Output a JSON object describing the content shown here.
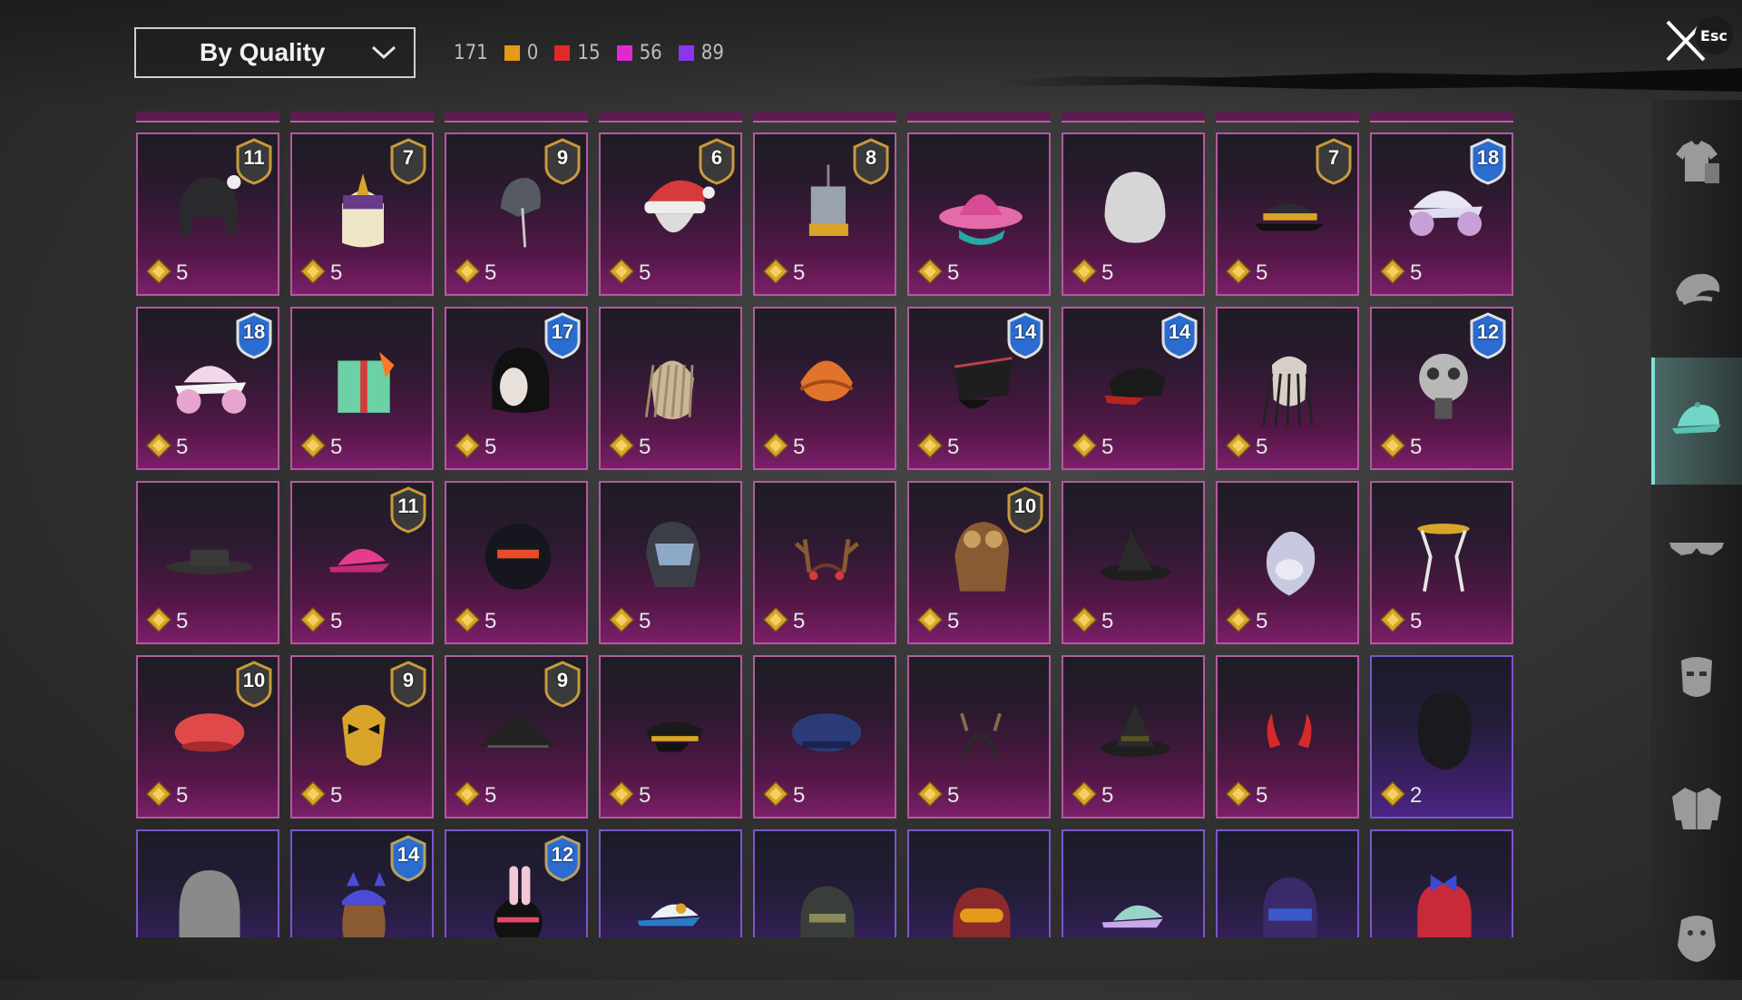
{
  "sort": {
    "label": "By Quality"
  },
  "counts": {
    "total": "171",
    "qualities": [
      {
        "value": "0",
        "color": "#e69a1a"
      },
      {
        "value": "15",
        "color": "#e02a2a"
      },
      {
        "value": "56",
        "color": "#e02ad0"
      },
      {
        "value": "89",
        "color": "#8a36f0"
      }
    ]
  },
  "close": {
    "key_hint": "Esc"
  },
  "sidebar": [
    {
      "icon": "clothing-icon",
      "active": false
    },
    {
      "icon": "hair-icon",
      "active": false
    },
    {
      "icon": "hat-icon",
      "active": true
    },
    {
      "icon": "glasses-icon",
      "active": false
    },
    {
      "icon": "mask-icon",
      "active": false
    },
    {
      "icon": "jacket-icon",
      "active": false
    },
    {
      "icon": "face-icon",
      "active": false
    }
  ],
  "items": [
    {
      "name": "horned-hat-icon",
      "price": "5",
      "level": "11",
      "tier": "magenta"
    },
    {
      "name": "crowned-helmet-icon",
      "price": "5",
      "level": "7",
      "tier": "magenta"
    },
    {
      "name": "metal-helmet-icon",
      "price": "5",
      "level": "9",
      "tier": "magenta"
    },
    {
      "name": "santa-hat-icon",
      "price": "5",
      "level": "6",
      "tier": "magenta"
    },
    {
      "name": "pot-hat-icon",
      "price": "5",
      "level": "8",
      "tier": "magenta"
    },
    {
      "name": "pink-cowboy-hat-icon",
      "price": "5",
      "level": "",
      "tier": "magenta"
    },
    {
      "name": "white-wig-icon",
      "price": "5",
      "level": "",
      "tier": "magenta"
    },
    {
      "name": "peaked-cap-icon",
      "price": "5",
      "level": "7",
      "tier": "magenta"
    },
    {
      "name": "headphone-cap-icon",
      "price": "5",
      "level": "18",
      "tier": "magenta"
    },
    {
      "name": "pink-cap-headphones-icon",
      "price": "5",
      "level": "18",
      "tier": "magenta"
    },
    {
      "name": "gift-box-hat-icon",
      "price": "5",
      "level": "",
      "tier": "magenta"
    },
    {
      "name": "black-helmet-icon",
      "price": "5",
      "level": "17",
      "tier": "magenta"
    },
    {
      "name": "dreadlock-mask-icon",
      "price": "5",
      "level": "",
      "tier": "magenta"
    },
    {
      "name": "turban-icon",
      "price": "5",
      "level": "",
      "tier": "magenta"
    },
    {
      "name": "spiked-visor-icon",
      "price": "5",
      "level": "14",
      "tier": "magenta"
    },
    {
      "name": "studded-cap-icon",
      "price": "5",
      "level": "14",
      "tier": "magenta"
    },
    {
      "name": "skull-dreadlock-icon",
      "price": "5",
      "level": "",
      "tier": "magenta"
    },
    {
      "name": "gas-mask-icon",
      "price": "5",
      "level": "12",
      "tier": "magenta"
    },
    {
      "name": "black-fedora-icon",
      "price": "5",
      "level": "",
      "tier": "magenta"
    },
    {
      "name": "pink-cap-icon",
      "price": "5",
      "level": "11",
      "tier": "magenta"
    },
    {
      "name": "robot-helmet-icon",
      "price": "5",
      "level": "",
      "tier": "magenta"
    },
    {
      "name": "visor-helmet-icon",
      "price": "5",
      "level": "",
      "tier": "magenta"
    },
    {
      "name": "antler-headband-icon",
      "price": "5",
      "level": "",
      "tier": "magenta"
    },
    {
      "name": "aviator-cap-icon",
      "price": "5",
      "level": "10",
      "tier": "magenta"
    },
    {
      "name": "witch-hat-icon",
      "price": "5",
      "level": "",
      "tier": "magenta"
    },
    {
      "name": "monkey-mask-icon",
      "price": "5",
      "level": "",
      "tier": "magenta"
    },
    {
      "name": "headband-icon",
      "price": "5",
      "level": "",
      "tier": "magenta"
    },
    {
      "name": "red-beret-icon",
      "price": "5",
      "level": "10",
      "tier": "magenta"
    },
    {
      "name": "gold-mask-icon",
      "price": "5",
      "level": "9",
      "tier": "magenta"
    },
    {
      "name": "conical-hat-icon",
      "price": "5",
      "level": "9",
      "tier": "magenta"
    },
    {
      "name": "officer-cap-icon",
      "price": "5",
      "level": "",
      "tier": "magenta"
    },
    {
      "name": "navy-beret-icon",
      "price": "5",
      "level": "",
      "tier": "magenta"
    },
    {
      "name": "horn-headband-icon",
      "price": "5",
      "level": "",
      "tier": "magenta"
    },
    {
      "name": "wizard-hat-icon",
      "price": "5",
      "level": "",
      "tier": "magenta"
    },
    {
      "name": "devil-horns-icon",
      "price": "5",
      "level": "",
      "tier": "magenta"
    },
    {
      "name": "black-hair-icon",
      "price": "2",
      "level": "",
      "tier": "purple"
    },
    {
      "name": "gray-wig-icon",
      "price": "",
      "level": "",
      "tier": "purple"
    },
    {
      "name": "cat-ear-cap-icon",
      "price": "",
      "level": "14",
      "tier": "purple"
    },
    {
      "name": "bunny-helmet-icon",
      "price": "",
      "level": "12",
      "tier": "purple"
    },
    {
      "name": "printed-cap-icon",
      "price": "",
      "level": "",
      "tier": "purple"
    },
    {
      "name": "tactical-helmet-icon",
      "price": "",
      "level": "",
      "tier": "purple"
    },
    {
      "name": "goggles-hair-icon",
      "price": "",
      "level": "",
      "tier": "purple"
    },
    {
      "name": "rainbow-cap-icon",
      "price": "",
      "level": "",
      "tier": "purple"
    },
    {
      "name": "purple-hair-icon",
      "price": "",
      "level": "",
      "tier": "purple"
    },
    {
      "name": "red-bow-hair-icon",
      "price": "",
      "level": "",
      "tier": "purple"
    }
  ]
}
